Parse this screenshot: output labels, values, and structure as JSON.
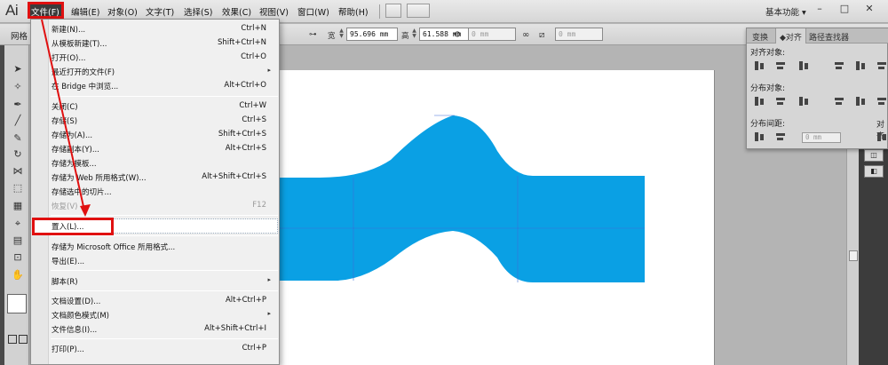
{
  "app": {
    "logo": "Ai"
  },
  "menubar": {
    "file": "文件(F)",
    "items": [
      "编辑(E)",
      "对象(O)",
      "文字(T)",
      "选择(S)",
      "效果(C)",
      "视图(V)",
      "窗口(W)",
      "帮助(H)"
    ],
    "workspace": "基本功能",
    "workspace_caret": "▾",
    "window_buttons": [
      "–",
      "□",
      "✕"
    ]
  },
  "controlbar": {
    "left_label": "网格",
    "width_label": "宽",
    "width_value": "95.696 mm",
    "height_label": "高",
    "height_value": "61.588 mm",
    "field3": "0 mm",
    "field4": "0 mm"
  },
  "file_menu": {
    "items": [
      {
        "label": "新建(N)...",
        "shortcut": "Ctrl+N"
      },
      {
        "label": "从模板新建(T)...",
        "shortcut": "Shift+Ctrl+N"
      },
      {
        "label": "打开(O)...",
        "shortcut": "Ctrl+O"
      },
      {
        "label": "最近打开的文件(F)",
        "shortcut": "",
        "submenu": "▸"
      },
      {
        "label": "在 Bridge 中浏览...",
        "shortcut": "Alt+Ctrl+O"
      },
      {
        "label": "关闭(C)",
        "shortcut": "Ctrl+W"
      },
      {
        "label": "存储(S)",
        "shortcut": "Ctrl+S"
      },
      {
        "label": "存储为(A)...",
        "shortcut": "Shift+Ctrl+S"
      },
      {
        "label": "存储副本(Y)...",
        "shortcut": "Alt+Ctrl+S"
      },
      {
        "label": "存储为模板...",
        "shortcut": ""
      },
      {
        "label": "存储为 Web 所用格式(W)...",
        "shortcut": "Alt+Shift+Ctrl+S"
      },
      {
        "label": "存储选中的切片...",
        "shortcut": ""
      },
      {
        "label": "恢复(V)",
        "shortcut": "F12",
        "disabled": true
      },
      {
        "label": "置入(L)...",
        "shortcut": ""
      },
      {
        "label": "存储为 Microsoft Office 所用格式...",
        "shortcut": ""
      },
      {
        "label": "导出(E)...",
        "shortcut": ""
      },
      {
        "label": "脚本(R)",
        "shortcut": "",
        "submenu": "▸"
      },
      {
        "label": "文档设置(D)...",
        "shortcut": "Alt+Ctrl+P"
      },
      {
        "label": "文档颜色模式(M)",
        "shortcut": "",
        "submenu": "▸"
      },
      {
        "label": "文件信息(I)...",
        "shortcut": "Alt+Shift+Ctrl+I"
      },
      {
        "label": "打印(P)...",
        "shortcut": "Ctrl+P"
      }
    ]
  },
  "align_panel": {
    "tabs": [
      "变换",
      "对齐",
      "路径查找器"
    ],
    "section_align_objects": "对齐对象:",
    "section_distribute_objects": "分布对象:",
    "section_distribute_spacing": "分布间距:",
    "section_align_to": "对齐",
    "spacing_value": "0 mm"
  },
  "colors": {
    "shape_fill": "#0aa0e4",
    "highlight": "#e01010"
  }
}
